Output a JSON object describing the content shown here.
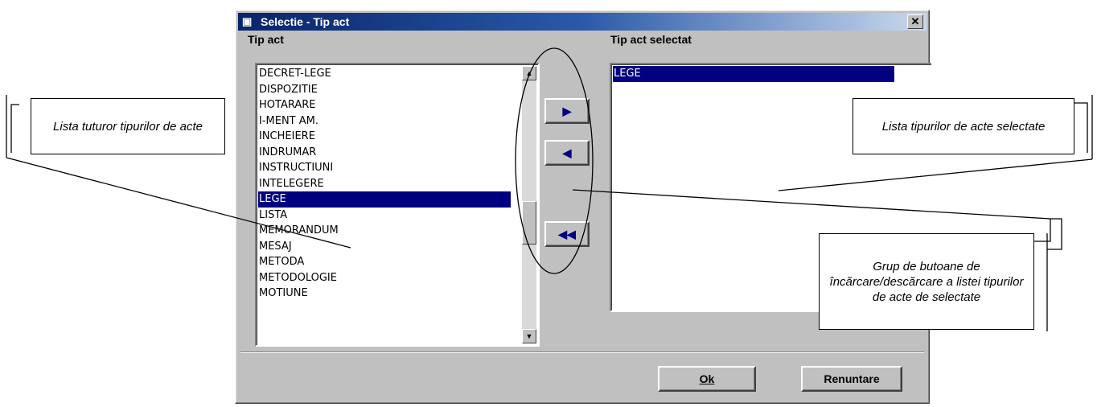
{
  "window": {
    "title": "Selectie - Tip act",
    "close_glyph": "✕"
  },
  "left_panel": {
    "label": "Tip act",
    "items": [
      "DECRET-LEGE",
      "DISPOZITIE",
      "HOTARARE",
      "I-MENT AM.",
      "INCHEIERE",
      "INDRUMAR",
      "INSTRUCTIUNI",
      "INTELEGERE",
      "LEGE",
      "LISTA",
      "MEMORANDUM",
      "MESAJ",
      "METODA",
      "METODOLOGIE",
      "MOTIUNE"
    ],
    "selected": "LEGE"
  },
  "right_panel": {
    "label": "Tip act selectat",
    "items": [
      "LEGE"
    ]
  },
  "transfer_buttons": {
    "add": "▶",
    "remove": "◀",
    "remove_all": "◀◀"
  },
  "footer": {
    "ok_label": "Ok",
    "cancel_label": "Renuntare"
  },
  "callouts": {
    "left_list": "Lista tuturor tipurilor de acte",
    "right_list": "Lista tipurilor de acte selectate",
    "buttons": "Grup de butoane de încărcare/descărcare a listei tipurilor de acte de selectate"
  },
  "icons": {
    "window_icon": "app-window-icon",
    "close": "close-icon",
    "scroll_up": "scroll-up-arrow-icon",
    "scroll_down": "scroll-down-arrow-icon"
  }
}
